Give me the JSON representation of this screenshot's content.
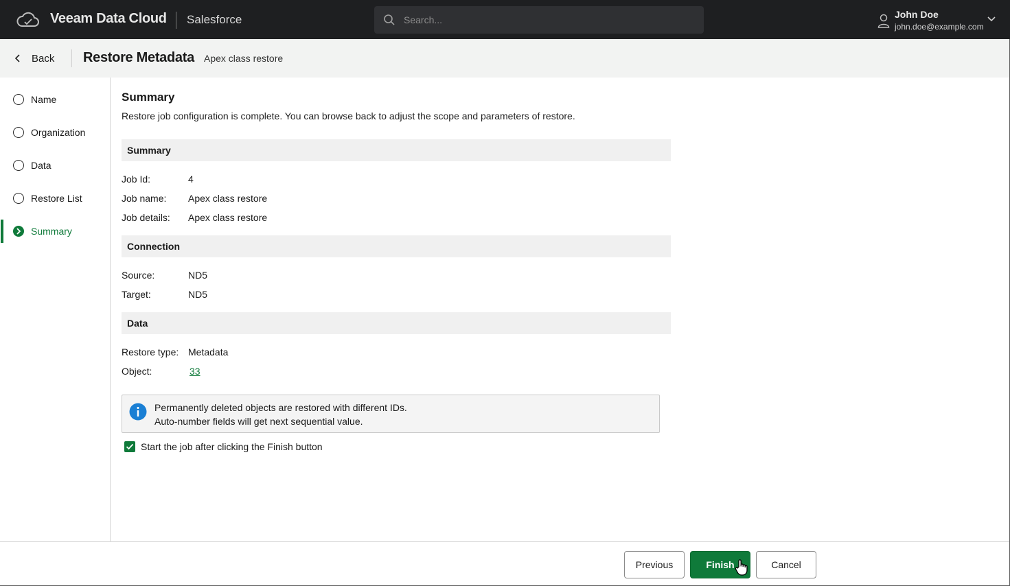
{
  "topbar": {
    "brand": "Veeam Data Cloud",
    "product": "Salesforce",
    "search_placeholder": "Search...",
    "user_name": "John Doe",
    "user_email": "john.doe@example.com"
  },
  "header": {
    "back_label": "Back",
    "title": "Restore Metadata",
    "subtitle": "Apex class restore"
  },
  "steps": [
    {
      "label": "Name",
      "active": false
    },
    {
      "label": "Organization",
      "active": false
    },
    {
      "label": "Data",
      "active": false
    },
    {
      "label": "Restore List",
      "active": false
    },
    {
      "label": "Summary",
      "active": true
    }
  ],
  "content": {
    "heading": "Summary",
    "description": "Restore job configuration is complete. You can browse back to adjust the scope and parameters of restore.",
    "sections": {
      "summary": {
        "title": "Summary",
        "job_id_label": "Job Id:",
        "job_id": "4",
        "job_name_label": "Job name:",
        "job_name": "Apex class restore",
        "job_details_label": "Job details:",
        "job_details": "Apex class restore"
      },
      "connection": {
        "title": "Connection",
        "source_label": "Source:",
        "source": "ND5",
        "target_label": "Target:",
        "target": "ND5"
      },
      "data": {
        "title": "Data",
        "restore_type_label": "Restore type:",
        "restore_type": "Metadata",
        "object_label": "Object:",
        "object": "33"
      }
    },
    "info": {
      "line1": "Permanently deleted objects are restored with different IDs.",
      "line2": "Auto-number fields will get next sequential value."
    },
    "start_job_label": "Start the job after clicking the Finish button",
    "start_job_checked": true
  },
  "footer": {
    "previous": "Previous",
    "finish": "Finish",
    "cancel": "Cancel"
  },
  "colors": {
    "accent_green": "#0f7a3a",
    "info_blue": "#1a7fd4",
    "topbar_bg": "#1e1f21"
  }
}
